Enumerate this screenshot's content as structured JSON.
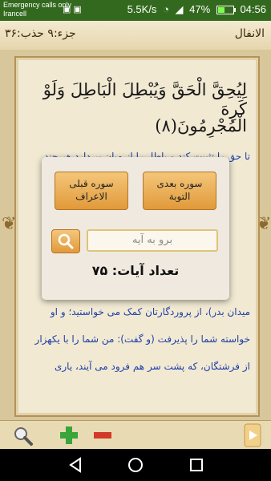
{
  "status": {
    "carrier_line1": "Emergency calls only",
    "carrier_line2": "Irancell",
    "speed": "5.5K/s",
    "battery": "47%",
    "battery_level": 0.47,
    "time": "04:56"
  },
  "header": {
    "surah_name": "الانفال",
    "juz_hizb": "جزء:۹ حذب:۳۶"
  },
  "verse": {
    "line1": "لِيُحِقَّ الْحَقَّ وَيُبْطِلَ الْبَاطِلَ وَلَوْ كَرِهَ",
    "line2": "الْمُجْرِمُونَ(٨)"
  },
  "translation": {
    "line1": "تا حق را تثبيت کند و باطل را از ميان بر دارد هر چند",
    "line2": "ميدان بدر)، از پروردگارتان کمک مى خواستيد؛ و او",
    "line3": "خواسته شما را پذيرفت (و گفت): من شما را با يکهزار",
    "line4": "از فرشتگان، که پشت سر هم فرود مى آيند، يارى"
  },
  "dialog": {
    "next_surah": "سوره بعدى\nالتوبة",
    "prev_surah": "سوره قبلى\nالاعراف",
    "goto_placeholder": "برو به آيه",
    "ayah_count": "تعداد آيات: ۷۵"
  },
  "colors": {
    "accent": "#e19a3a",
    "translation_text": "#1f3fa8",
    "status_bar": "#33691e"
  }
}
